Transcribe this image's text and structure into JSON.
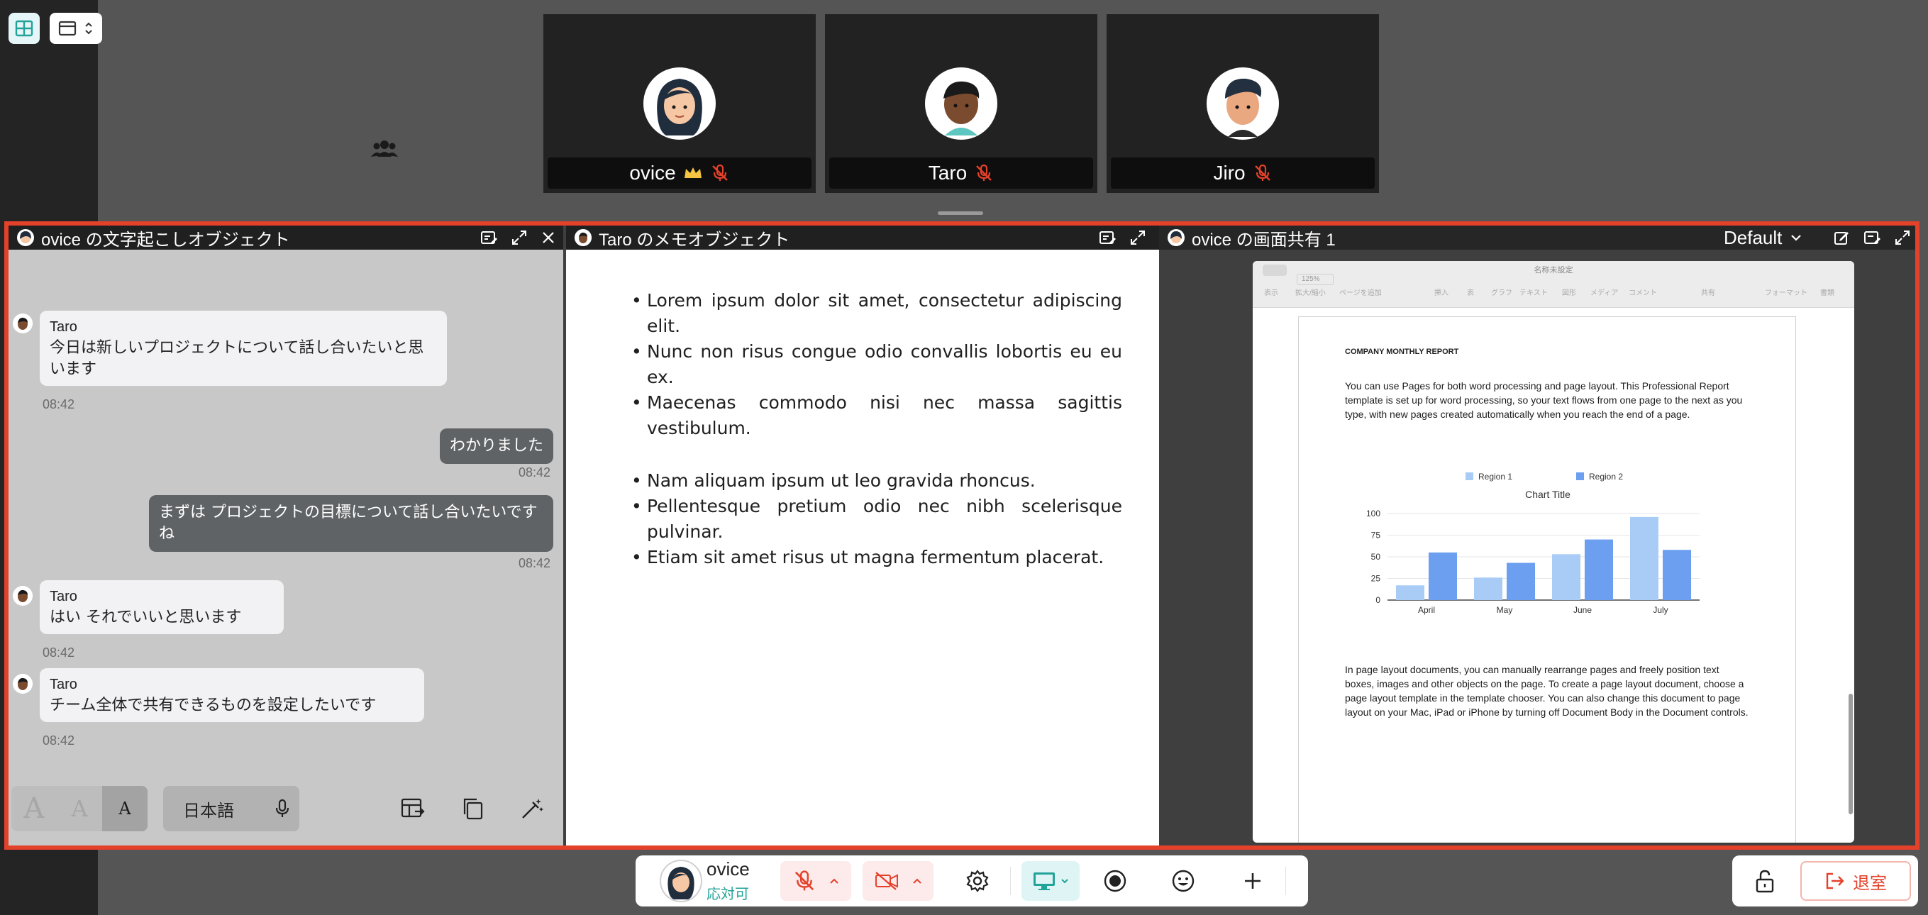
{
  "participants": [
    {
      "name": "ovice",
      "badge": "crown-icon",
      "muted": true
    },
    {
      "name": "Taro",
      "muted": true
    },
    {
      "name": "Jiro",
      "muted": true
    }
  ],
  "transcription": {
    "title": "ovice の文字起こしオブジェクト",
    "messages": [
      {
        "speaker": "Taro",
        "text": "今日は新しいプロジェクトについて話し合いたいと思います",
        "time": "08:42"
      },
      {
        "text": "わかりました",
        "time": "08:42"
      },
      {
        "text": "まずは プロジェクトの目標について話し合いたいですね",
        "time": "08:42"
      },
      {
        "speaker": "Taro",
        "text": "はい それでいいと思います",
        "time": "08:42"
      },
      {
        "speaker": "Taro",
        "text": "チーム全体で共有できるものを設定したいです",
        "time": "08:42"
      }
    ],
    "font_sizes": [
      "A",
      "A",
      "A"
    ],
    "language": "日本語"
  },
  "memo": {
    "title": "Taro のメモオブジェクト",
    "list1": [
      "Lorem ipsum dolor sit amet, consectetur adipiscing elit.",
      "Nunc non risus congue odio convallis lobortis eu eu ex.",
      "Maecenas commodo nisi nec massa sagittis vestibulum."
    ],
    "list2": [
      "Nam aliquam ipsum ut leo gravida rhoncus.",
      "Pellentesque pretium odio nec nibh scelerisque pulvinar.",
      "Etiam sit amet risus ut magna fermentum placerat."
    ]
  },
  "share": {
    "title": "ovice の画面共有 1",
    "layout_select": "Default",
    "doc": {
      "window_title": "名称未設定",
      "zoom": "125%",
      "toolbar_items": [
        "表示",
        "拡大/縮小",
        "ページを追加",
        "挿入",
        "表",
        "グラフ",
        "テキスト",
        "図形",
        "メディア",
        "コメント",
        "共有",
        "フォーマット",
        "書類"
      ],
      "heading": "COMPANY MONTHLY REPORT",
      "para1": "You can use Pages for both word processing and page layout. This Professional Report template is set up for word processing, so your text flows from one page to the next as you type, with new pages created automatically when you reach the end of a page.",
      "para2": "In page layout documents, you can manually rearrange pages and freely position text boxes, images and other objects on the page. To create a page layout document, choose a page layout template in the template chooser. You can also change this document to page layout on your Mac, iPad or iPhone by turning off Document Body in the Document controls."
    }
  },
  "chart_data": {
    "type": "bar",
    "title": "Chart Title",
    "categories": [
      "April",
      "May",
      "June",
      "July"
    ],
    "series": [
      {
        "name": "Region 1",
        "values": [
          17,
          26,
          53,
          96
        ],
        "color": "#a8ccf5"
      },
      {
        "name": "Region 2",
        "values": [
          55,
          43,
          70,
          58
        ],
        "color": "#6c9ff0"
      }
    ],
    "yticks": [
      0,
      25,
      50,
      75,
      100
    ],
    "ylim": [
      0,
      100
    ],
    "legend": "top"
  },
  "controls": {
    "user_name": "ovice",
    "user_status": "応対可",
    "leave_label": "退室"
  },
  "colors": {
    "accent_red": "#e4412b",
    "teal": "#22a39a"
  }
}
